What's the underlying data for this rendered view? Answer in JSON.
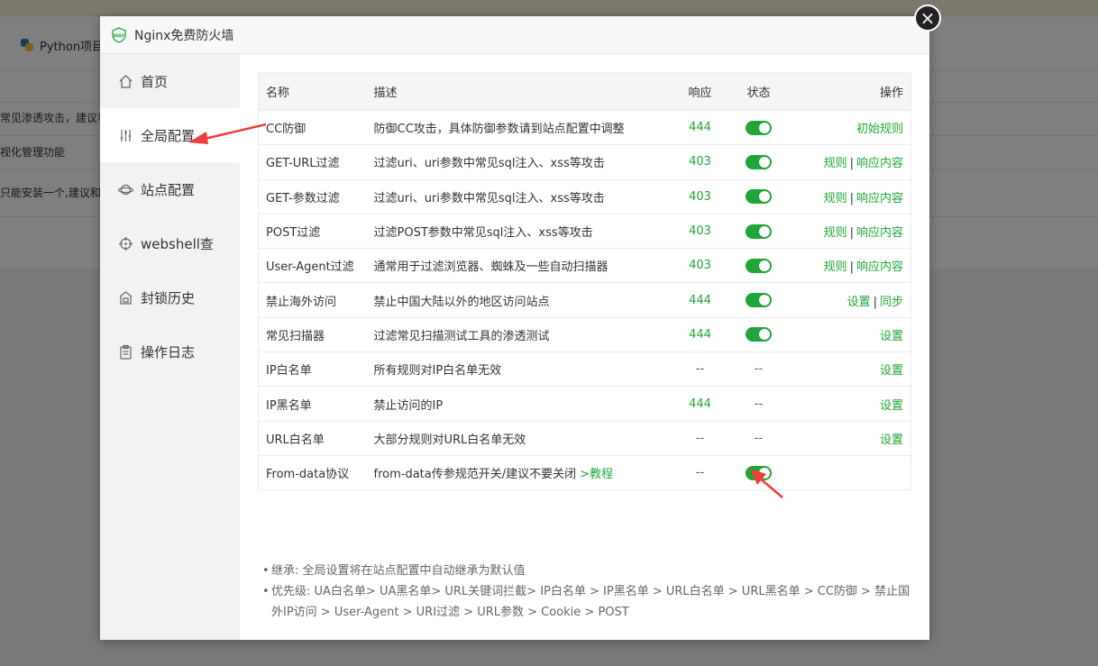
{
  "background": {
    "tab_label": "Python项目",
    "rows": [
      "常见渗透攻击，建议和",
      "视化管理功能",
      "只能安装一个,建议和"
    ]
  },
  "dialog": {
    "title": "Nginx免费防火墙",
    "close_glyph": "×"
  },
  "sidebar": {
    "items": [
      {
        "label": "首页",
        "icon": "home-icon"
      },
      {
        "label": "全局配置",
        "icon": "sliders-icon"
      },
      {
        "label": "站点配置",
        "icon": "globe-icon"
      },
      {
        "label": "webshell查",
        "icon": "target-icon"
      },
      {
        "label": "封锁历史",
        "icon": "lock-building-icon"
      },
      {
        "label": "操作日志",
        "icon": "clipboard-icon"
      }
    ],
    "active_index": 1
  },
  "table": {
    "headers": {
      "name": "名称",
      "desc": "描述",
      "resp": "响应",
      "state": "状态",
      "op": "操作"
    },
    "rows": [
      {
        "name": "CC防御",
        "desc": "防御CC攻击，具体防御参数请到站点配置中调整",
        "resp": "444",
        "state": "on",
        "ops": [
          "初始规则"
        ]
      },
      {
        "name": "GET-URL过滤",
        "desc": "过滤uri、uri参数中常见sql注入、xss等攻击",
        "resp": "403",
        "state": "on",
        "ops": [
          "规则",
          "响应内容"
        ]
      },
      {
        "name": "GET-参数过滤",
        "desc": "过滤uri、uri参数中常见sql注入、xss等攻击",
        "resp": "403",
        "state": "on",
        "ops": [
          "规则",
          "响应内容"
        ]
      },
      {
        "name": "POST过滤",
        "desc": "过滤POST参数中常见sql注入、xss等攻击",
        "resp": "403",
        "state": "on",
        "ops": [
          "规则",
          "响应内容"
        ]
      },
      {
        "name": "User-Agent过滤",
        "desc": "通常用于过滤浏览器、蜘蛛及一些自动扫描器",
        "resp": "403",
        "state": "on",
        "ops": [
          "规则",
          "响应内容"
        ]
      },
      {
        "name": "禁止海外访问",
        "desc": "禁止中国大陆以外的地区访问站点",
        "resp": "444",
        "state": "on",
        "ops": [
          "设置",
          "同步"
        ]
      },
      {
        "name": "常见扫描器",
        "desc": "过滤常见扫描测试工具的渗透测试",
        "resp": "444",
        "state": "on",
        "ops": [
          "设置"
        ]
      },
      {
        "name": "IP白名单",
        "desc": "所有规则对IP白名单无效",
        "resp": "--",
        "state": "--",
        "ops": [
          "设置"
        ]
      },
      {
        "name": "IP黑名单",
        "desc": "禁止访问的IP",
        "resp": "444",
        "state": "--",
        "ops": [
          "设置"
        ]
      },
      {
        "name": "URL白名单",
        "desc": "大部分规则对URL白名单无效",
        "resp": "--",
        "state": "--",
        "ops": [
          "设置"
        ]
      },
      {
        "name": "From-data协议",
        "desc": "from-data传参规范开关/建议不要关闭",
        "desc_link": ">教程",
        "resp": "--",
        "state": "on",
        "ops": []
      }
    ]
  },
  "notes": [
    "继承: 全局设置将在站点配置中自动继承为默认值",
    "优先级: UA白名单> UA黑名单> URL关键词拦截> IP白名单 > IP黑名单 > URL白名单 > URL黑名单 > CC防御 > 禁止国外IP访问 > User-Agent > URI过滤 > URL参数 > Cookie > POST"
  ],
  "colors": {
    "accent_green": "#20a53a",
    "annotation_red": "#f03c3c"
  }
}
